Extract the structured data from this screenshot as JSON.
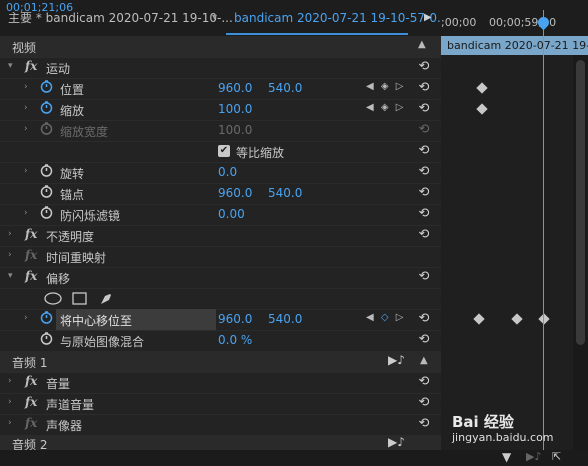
{
  "tabs": {
    "main_label": "主要 * bandicam 2020-07-21 19-10-...",
    "active_label": "bandicam 2020-07-21 19-10-57-0..."
  },
  "ruler": {
    "tc1": ";00;00",
    "tc2": "00;00;59;30"
  },
  "clip": {
    "name": "bandicam 2020-07-21 19-1"
  },
  "sections": {
    "video": "视频",
    "audio1": "音频 1",
    "audio2": "音频 2"
  },
  "effects": {
    "motion": "运动",
    "position": {
      "label": "位置",
      "x": "960.0",
      "y": "540.0"
    },
    "scale": {
      "label": "缩放",
      "value": "100.0"
    },
    "scale_width": {
      "label": "缩放宽度",
      "value": "100.0"
    },
    "uniform": {
      "label": "等比缩放"
    },
    "rotation": {
      "label": "旋转",
      "value": "0.0"
    },
    "anchor": {
      "label": "锚点",
      "x": "960.0",
      "y": "540.0"
    },
    "flicker": {
      "label": "防闪烁滤镜",
      "value": "0.00"
    },
    "opacity": "不透明度",
    "time_remap": "时间重映射",
    "offset": "偏移",
    "shift_center": {
      "label": "将中心移位至",
      "x": "960.0",
      "y": "540.0"
    },
    "blend": {
      "label": "与原始图像混合",
      "value": "0.0 %"
    },
    "volume": "音量",
    "channel_volume": "声道音量",
    "panner": "声像器"
  },
  "footer": {
    "timecode": "00;01;21;06"
  },
  "watermark": {
    "line1": "Bai 经验",
    "line2": "jingyan.baidu.com"
  },
  "colors": {
    "accent": "#4aa3f0",
    "clip": "#7aa7c9"
  },
  "icons": [
    "stopwatch-icon",
    "reset-icon",
    "keyframe-icon",
    "ellipse-mask-icon",
    "rect-mask-icon",
    "pen-mask-icon",
    "play-icon"
  ]
}
